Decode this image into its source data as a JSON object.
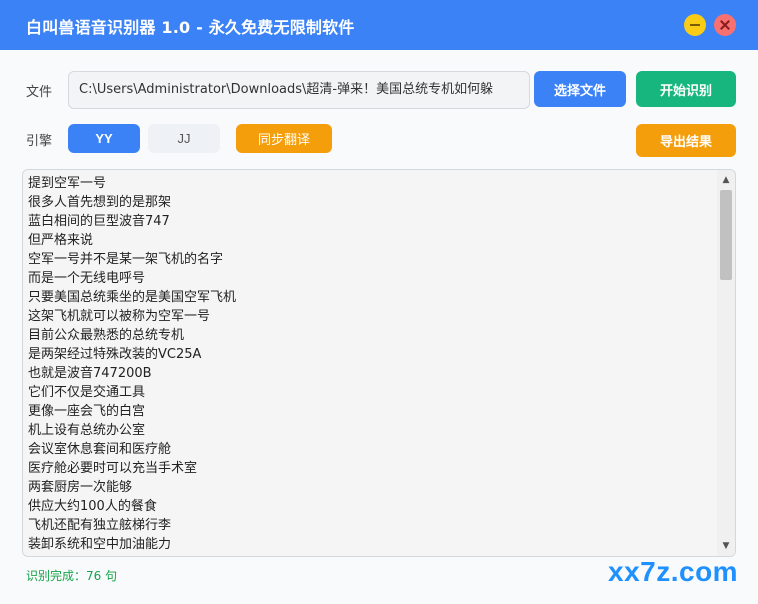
{
  "window": {
    "title": "白叫兽语音识别器 1.0 - 永久免费无限制软件"
  },
  "file": {
    "label": "文件",
    "path": "C:\\Users\\Administrator\\Downloads\\超清-弹来！美国总统专机如何躲",
    "select_button": "选择文件",
    "start_button": "开始识别"
  },
  "engine": {
    "label": "引擎",
    "options": [
      "YY",
      "JJ"
    ],
    "selected": "YY",
    "translate_button": "同步翻译",
    "export_button": "导出结果"
  },
  "results": {
    "lines": [
      "提到空军一号",
      "很多人首先想到的是那架",
      "蓝白相间的巨型波音747",
      "但严格来说",
      "空军一号并不是某一架飞机的名字",
      "而是一个无线电呼号",
      "只要美国总统乘坐的是美国空军飞机",
      "这架飞机就可以被称为空军一号",
      "目前公众最熟悉的总统专机",
      "是两架经过特殊改装的VC25A",
      "也就是波音747200B",
      "它们不仅是交通工具",
      "更像一座会飞的白宫",
      "机上设有总统办公室",
      "会议室休息套间和医疗舱",
      "医疗舱必要时可以充当手术室",
      "两套厨房一次能够",
      "供应大约100人的餐食",
      "飞机还配有独立舷梯行李",
      "装卸系统和空中加油能力"
    ]
  },
  "status": {
    "text": "识别完成：76 句"
  },
  "watermark": "xx7z.com",
  "colors": {
    "primary": "#3b82f6",
    "success": "#16b67e",
    "warning": "#f59e0b"
  }
}
